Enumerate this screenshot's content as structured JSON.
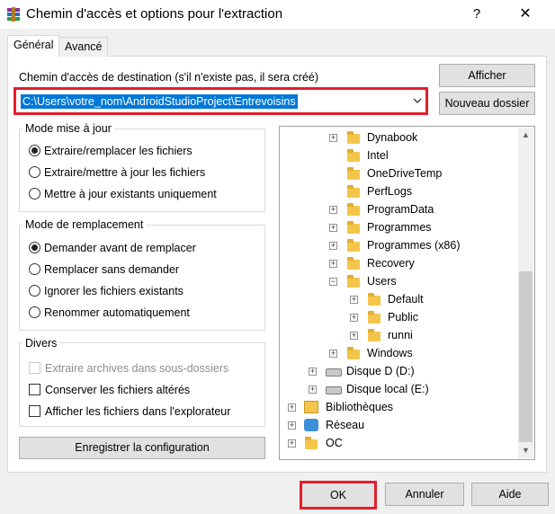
{
  "window": {
    "title": "Chemin d'accès et options pour l'extraction",
    "help_glyph": "?",
    "close_glyph": "✕",
    "app_icon": "winrar-icon"
  },
  "tabs": [
    {
      "label": "Général",
      "active": true
    },
    {
      "label": "Avancé",
      "active": false
    }
  ],
  "destination": {
    "label": "Chemin d'accès de destination (s'il n'existe pas, il sera créé)",
    "value": "C:\\Users\\votre_nom\\AndroidStudioProject\\Entrevoisins",
    "highlight_color": "#e41e2c"
  },
  "side_buttons": {
    "show": "Afficher",
    "new_folder": "Nouveau dossier"
  },
  "update_mode": {
    "title": "Mode mise à jour",
    "options": [
      {
        "label": "Extraire/remplacer les fichiers",
        "selected": true
      },
      {
        "label": "Extraire/mettre à jour les fichiers",
        "selected": false
      },
      {
        "label": "Mettre à jour existants uniquement",
        "selected": false
      }
    ]
  },
  "overwrite_mode": {
    "title": "Mode de remplacement",
    "options": [
      {
        "label": "Demander avant de remplacer",
        "selected": true
      },
      {
        "label": "Remplacer sans demander",
        "selected": false
      },
      {
        "label": "Ignorer les fichiers existants",
        "selected": false
      },
      {
        "label": "Renommer automatiquement",
        "selected": false
      }
    ]
  },
  "misc": {
    "title": "Divers",
    "options": [
      {
        "label": "Extraire archives dans sous-dossiers",
        "checked": false,
        "enabled": false
      },
      {
        "label": "Conserver les fichiers altérés",
        "checked": false,
        "enabled": true
      },
      {
        "label": "Afficher les fichiers dans l'explorateur",
        "checked": false,
        "enabled": true
      }
    ]
  },
  "save_config_label": "Enregistrer la configuration",
  "tree": {
    "items": [
      {
        "label": "Dynabook",
        "icon": "folder-icon",
        "expander": "+"
      },
      {
        "label": "Intel",
        "icon": "folder-icon",
        "expander": ""
      },
      {
        "label": "OneDriveTemp",
        "icon": "folder-icon",
        "expander": ""
      },
      {
        "label": "PerfLogs",
        "icon": "folder-icon",
        "expander": ""
      },
      {
        "label": "ProgramData",
        "icon": "folder-icon",
        "expander": "+"
      },
      {
        "label": "Programmes",
        "icon": "folder-icon",
        "expander": "+"
      },
      {
        "label": "Programmes (x86)",
        "icon": "folder-icon",
        "expander": "+"
      },
      {
        "label": "Recovery",
        "icon": "folder-icon",
        "expander": "+"
      },
      {
        "label": "Users",
        "icon": "folder-icon",
        "expander": "−"
      },
      {
        "label": "Default",
        "icon": "folder-icon",
        "expander": "+"
      },
      {
        "label": "Public",
        "icon": "folder-icon",
        "expander": "+"
      },
      {
        "label": "runni",
        "icon": "folder-icon",
        "expander": "+"
      },
      {
        "label": "Windows",
        "icon": "folder-icon",
        "expander": "+"
      },
      {
        "label": "Disque D (D:)",
        "icon": "drive-icon",
        "expander": "+"
      },
      {
        "label": "Disque local (E:)",
        "icon": "drive-icon",
        "expander": "+"
      },
      {
        "label": "Bibliothèques",
        "icon": "library-icon",
        "expander": "+"
      },
      {
        "label": "Réseau",
        "icon": "network-icon",
        "expander": "+"
      },
      {
        "label": "OC",
        "icon": "folder-icon",
        "expander": "+"
      }
    ]
  },
  "footer": {
    "ok": "OK",
    "cancel": "Annuler",
    "help": "Aide"
  }
}
